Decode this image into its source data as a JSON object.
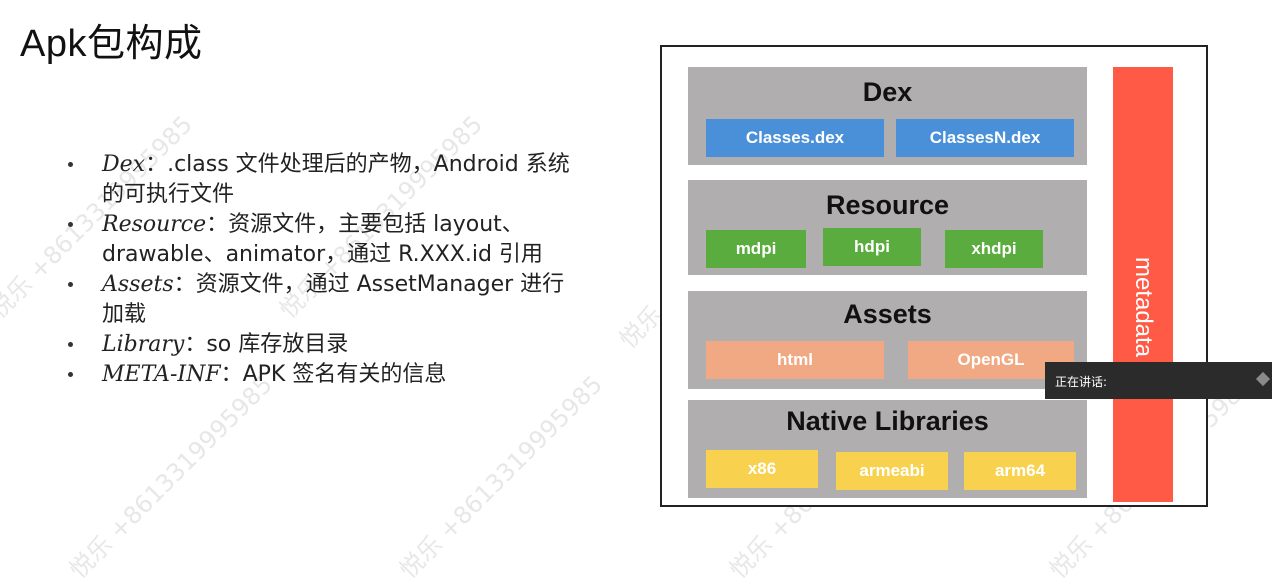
{
  "slide": {
    "title": "Apk包构成"
  },
  "bullets": [
    {
      "name": "Dex",
      "desc": "：.class 文件处理后的产物，Android 系统的可执行文件"
    },
    {
      "name": "Resource",
      "desc": "：资源文件，主要包括 layout、drawable、animator，通过 R.XXX.id 引用"
    },
    {
      "name": "Assets",
      "desc": "：资源文件，通过 AssetManager 进行加载"
    },
    {
      "name": "Library",
      "desc": "：so 库存放目录"
    },
    {
      "name": "META-INF",
      "desc": "：APK 签名有关的信息"
    }
  ],
  "diagram": {
    "dex": {
      "title": "Dex",
      "items": [
        "Classes.dex",
        "ClassesN.dex"
      ]
    },
    "resource": {
      "title": "Resource",
      "items": [
        "mdpi",
        "hdpi",
        "xhdpi"
      ]
    },
    "assets": {
      "title": "Assets",
      "items": [
        "html",
        "OpenGL"
      ]
    },
    "native": {
      "title": "Native Libraries",
      "items": [
        "x86",
        "armeabi",
        "arm64"
      ]
    },
    "metadata": "metadata"
  },
  "overlay": {
    "speaking_label": "正在讲话:"
  },
  "watermark": "悦乐 +8613319995985",
  "colors": {
    "block_gray": "#b0aeae",
    "dex_blue": "#4a90d9",
    "resource_green": "#5aac3e",
    "assets_peach": "#f0a982",
    "native_yellow": "#f8d24f",
    "metadata_red": "#ff5a45"
  }
}
